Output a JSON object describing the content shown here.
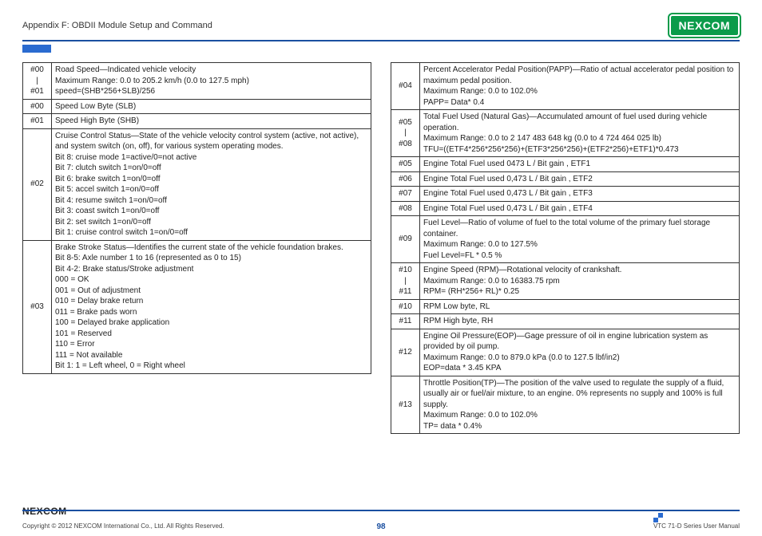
{
  "header": {
    "appendix_title": "Appendix F: OBDII Module Setup and Command",
    "logo_text": "NEXCOM"
  },
  "left_table": [
    {
      "code": "#00\n|\n#01",
      "desc": "Road Speed—Indicated vehicle velocity\nMaximum Range: 0.0 to 205.2 km/h (0.0 to 127.5 mph)\nspeed=(SHB*256+SLB)/256"
    },
    {
      "code": "#00",
      "desc": "Speed Low Byte (SLB)"
    },
    {
      "code": "#01",
      "desc": "Speed High Byte (SHB)"
    },
    {
      "code": "#02",
      "desc": "Cruise Control Status—State of the vehicle velocity control system (active, not active), and system switch (on, off), for various system operating modes.\nBit 8: cruise mode 1=active/0=not active\nBit 7: clutch switch 1=on/0=off\nBit 6: brake switch 1=on/0=off\nBit 5: accel switch 1=on/0=off\nBit 4: resume switch 1=on/0=off\nBit 3: coast switch 1=on/0=off\nBit 2: set switch 1=on/0=off\nBit 1: cruise control switch 1=on/0=off"
    },
    {
      "code": "#03",
      "desc": "Brake Stroke Status—Identifies the current state of the vehicle foundation brakes.\nBit 8-5: Axle number 1 to 16 (represented as 0 to 15)\nBit 4-2: Brake status/Stroke adjustment\n000 = OK\n001 = Out of adjustment\n010 = Delay brake return\n011 = Brake pads worn\n100 = Delayed brake application\n101 = Reserved\n110 = Error\n111 = Not available\nBit 1: 1 = Left wheel, 0 = Right wheel"
    }
  ],
  "right_table": [
    {
      "code": "#04",
      "desc": "Percent Accelerator Pedal Position(PAPP)—Ratio of actual accelerator pedal position to maximum pedal position.\nMaximum Range: 0.0 to 102.0%\nPAPP= Data* 0.4"
    },
    {
      "code": "#05\n|\n#08",
      "desc": "Total Fuel Used (Natural Gas)—Accumulated amount of fuel used during vehicle operation.\nMaximum Range: 0.0 to 2 147 483 648 kg (0.0 to 4 724 464 025 lb)\nTFU=((ETF4*256*256*256)+(ETF3*256*256)+(ETF2*256)+ETF1)*0.473"
    },
    {
      "code": "#05",
      "desc": "Engine Total Fuel used 0473 L / Bit gain , ETF1"
    },
    {
      "code": "#06",
      "desc": "Engine Total Fuel used 0,473 L / Bit gain , ETF2"
    },
    {
      "code": "#07",
      "desc": "Engine Total Fuel used 0,473 L / Bit gain , ETF3"
    },
    {
      "code": "#08",
      "desc": "Engine Total Fuel used 0,473 L / Bit gain , ETF4"
    },
    {
      "code": "#09",
      "desc": "Fuel Level—Ratio of volume of fuel to the total volume of the primary fuel storage container.\nMaximum Range: 0.0 to 127.5%\nFuel Level=FL * 0.5 %"
    },
    {
      "code": "#10\n|\n#11",
      "desc": "Engine Speed (RPM)—Rotational velocity of crankshaft.\nMaximum Range: 0.0 to 16383.75 rpm\nRPM= (RH*256+ RL)* 0.25"
    },
    {
      "code": "#10",
      "desc": "RPM Low byte, RL"
    },
    {
      "code": "#11",
      "desc": "RPM High byte, RH"
    },
    {
      "code": "#12",
      "desc": "Engine Oil Pressure(EOP)—Gage pressure of oil in engine lubrication system as provided by oil pump.\nMaximum Range: 0.0 to 879.0 kPa (0.0 to 127.5 lbf/in2)\nEOP=data * 3.45 KPA"
    },
    {
      "code": "#13",
      "desc": "Throttle Position(TP)—The position of the valve used to regulate the supply of a fluid, usually air or fuel/air mixture, to an engine. 0% represents no supply and 100% is full supply.\nMaximum Range: 0.0 to 102.0%\nTP= data * 0.4%"
    }
  ],
  "footer": {
    "copyright": "Copyright © 2012 NEXCOM International Co., Ltd. All Rights Reserved.",
    "page_number": "98",
    "manual_name": "VTC 71-D Series User Manual",
    "footer_logo": "NEXCOM"
  }
}
